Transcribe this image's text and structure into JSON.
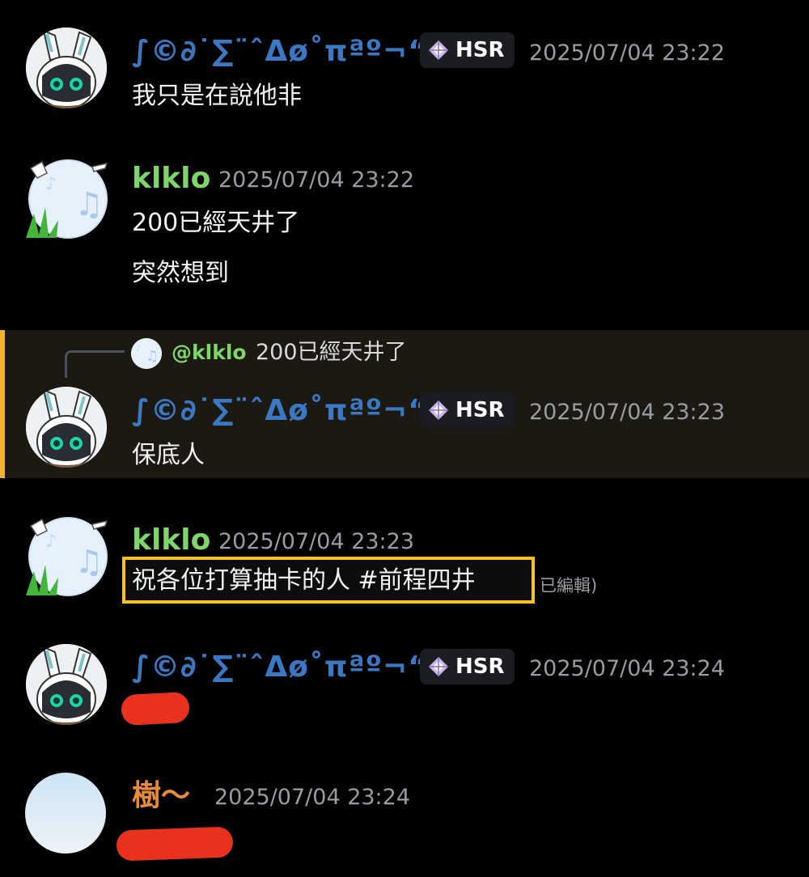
{
  "users": {
    "stylized": "∫©∂˙∑¨ˆΔø˚πªº¬“≤...",
    "klklo": "klklo",
    "tree": "樹～"
  },
  "tag": {
    "icon": "diamond-icon",
    "label": "HSR"
  },
  "messages": [
    {
      "author": "∫©∂˙∑¨ˆΔø˚πªº¬“≤...",
      "time": "2025/07/04 23:22",
      "lines": [
        "我只是在說他非"
      ]
    },
    {
      "author": "klklo",
      "time": "2025/07/04 23:22",
      "lines": [
        "200已經天井了",
        "突然想到"
      ]
    },
    {
      "reply": {
        "mention": "@klklo",
        "text": "200已經天井了"
      },
      "author": "∫©∂˙∑¨ˆΔø˚πªº¬“≤...",
      "time": "2025/07/04 23:23",
      "lines": [
        "保底人"
      ]
    },
    {
      "author": "klklo",
      "time": "2025/07/04 23:23",
      "lines": [
        "祝各位打算抽卡的人 #前程四井"
      ],
      "edited": "已編輯)"
    },
    {
      "author": "∫©∂˙∑¨ˆΔø˚πªº¬“≤...",
      "time": "2025/07/04 23:24",
      "lines": []
    },
    {
      "author": "樹～",
      "time": "2025/07/04 23:24",
      "lines": []
    }
  ],
  "colors": {
    "background": "#000000",
    "reply_highlight": "#1c1812",
    "reply_bar": "#f0b232",
    "name_blue": "#3a78c3",
    "name_green": "#7fd46a",
    "name_orange": "#e88a3a",
    "highlight_box": "#f6c21b",
    "redaction": "#e8321e"
  }
}
